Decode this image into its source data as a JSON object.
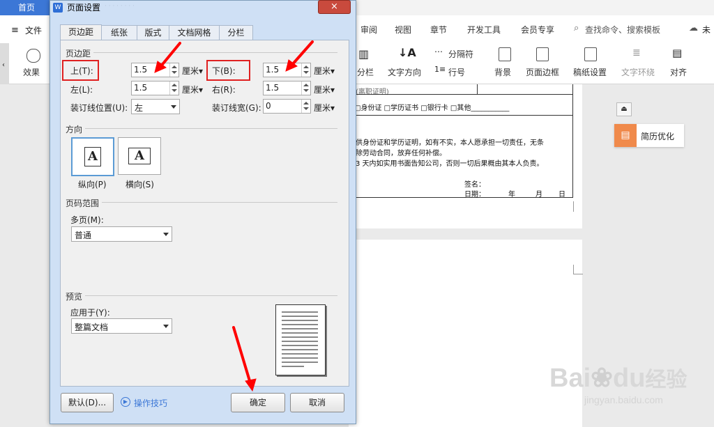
{
  "app": {
    "home_tab": "首页",
    "menu": [
      "审阅",
      "视图",
      "章节",
      "开发工具",
      "会员专享"
    ],
    "search_placeholder": "查找命令、搜索模板",
    "cloud_label": "未",
    "file_label": "文件",
    "effects_label": "效果",
    "ribbon_buttons": [
      "分栏",
      "文字方向",
      "分隔符",
      "行号",
      "背景",
      "页面边框",
      "稿纸设置",
      "文字环绕",
      "对齐"
    ],
    "side_button": "简历优化"
  },
  "document": {
    "line1": "□身份证    □学历证书    □银行卡    □其他___________",
    "line2": "供身份证和学历证明，如有不实，本人愿承担一切责任，无条",
    "line3": "除劳动合同，放弃任何补偿。",
    "line4": "3 天内如实用书面告知公司，否则一切后果概由其本人负责。",
    "sign": "签名：",
    "date_label": "日期：",
    "year": "年",
    "month": "月",
    "day": "日",
    "top_cut": "(离职证明)"
  },
  "dialog": {
    "title": "页面设置",
    "close": "×",
    "tabs": [
      "页边距",
      "纸张",
      "版式",
      "文档网格",
      "分栏"
    ],
    "margins_group": "页边距",
    "top_label": "上(T):",
    "top_value": "1.5",
    "bottom_label": "下(B):",
    "bottom_value": "1.5",
    "left_label": "左(L):",
    "left_value": "1.5",
    "right_label": "右(R):",
    "right_value": "1.5",
    "gutter_pos_label": "装订线位置(U):",
    "gutter_pos_value": "左",
    "gutter_width_label": "装订线宽(G):",
    "gutter_width_value": "0",
    "unit": "厘米",
    "orientation_group": "方向",
    "portrait": "纵向(P)",
    "landscape": "横向(S)",
    "orientation_glyph": "A",
    "pages_group": "页码范围",
    "multi_label": "多页(M):",
    "multi_value": "普通",
    "preview_group": "预览",
    "apply_label": "应用于(Y):",
    "apply_value": "整篇文档",
    "default_btn": "默认(D)...",
    "tips_link": "操作技巧",
    "ok_btn": "确定",
    "cancel_btn": "取消"
  },
  "watermark": {
    "brand": "Bai",
    "brand2": "du",
    "brand3": "经验",
    "url": "jingyan.baidu.com"
  },
  "colors": {
    "accent": "#3c77d6",
    "annotation": "#ff0000",
    "side_icon": "#f08a4b"
  }
}
